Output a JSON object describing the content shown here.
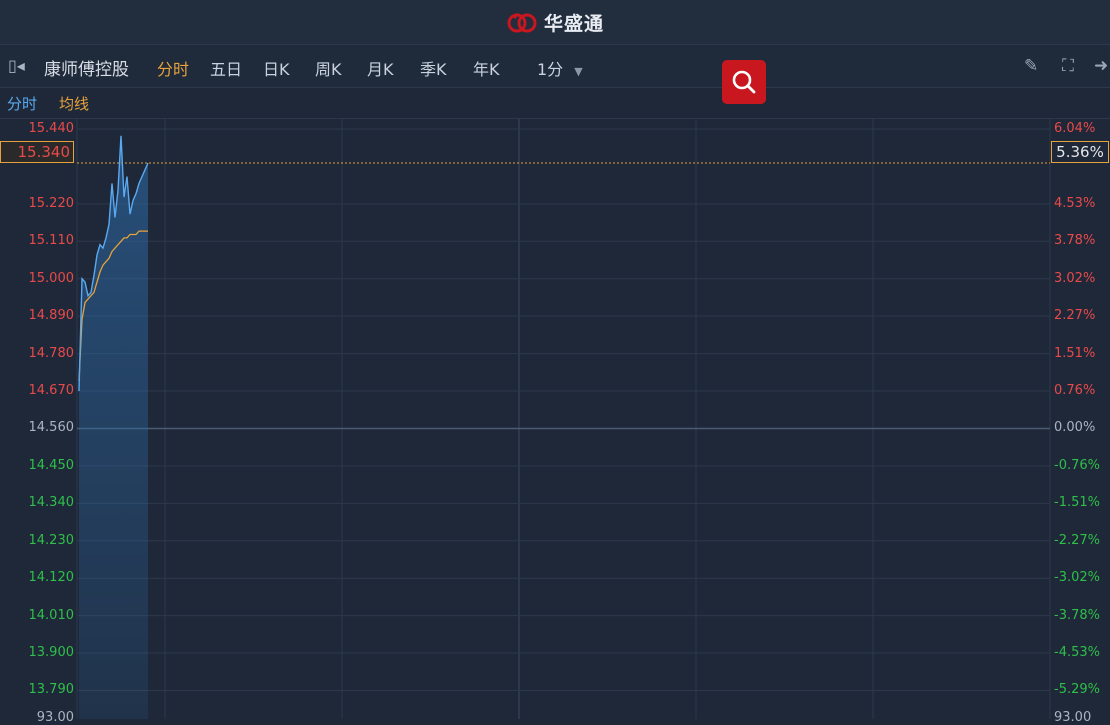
{
  "app": {
    "brand": "华盛通"
  },
  "toolbar": {
    "stock_name": "康师傅控股",
    "periods": [
      {
        "label": "分时",
        "active": true
      },
      {
        "label": "五日",
        "active": false
      },
      {
        "label": "日K",
        "active": false
      },
      {
        "label": "周K",
        "active": false
      },
      {
        "label": "月K",
        "active": false
      },
      {
        "label": "季K",
        "active": false
      },
      {
        "label": "年K",
        "active": false
      }
    ],
    "interval": "1分"
  },
  "legend": {
    "price": "分时",
    "avg": "均线"
  },
  "colors": {
    "price_line": "#5aa9f0",
    "avg_line": "#e6a23c",
    "up": "#e84a4a",
    "down": "#2fbf4a",
    "flat": "#aab4c2",
    "brand_red": "#c8171e"
  },
  "current": {
    "price": "15.340",
    "pct": "5.36%"
  },
  "bottom_label": "93.00",
  "chart_data": {
    "type": "line",
    "prev_close": 14.56,
    "ylim": [
      13.735,
      15.44
    ],
    "y_ticks": [
      {
        "price": "15.440",
        "pct": "6.04%"
      },
      {
        "price": "15.220",
        "pct": "4.53%"
      },
      {
        "price": "15.110",
        "pct": "3.78%"
      },
      {
        "price": "15.000",
        "pct": "3.02%"
      },
      {
        "price": "14.890",
        "pct": "2.27%"
      },
      {
        "price": "14.780",
        "pct": "1.51%"
      },
      {
        "price": "14.670",
        "pct": "0.76%"
      },
      {
        "price": "14.560",
        "pct": "0.00%"
      },
      {
        "price": "14.450",
        "pct": "-0.76%"
      },
      {
        "price": "14.340",
        "pct": "-1.51%"
      },
      {
        "price": "14.230",
        "pct": "-2.27%"
      },
      {
        "price": "14.120",
        "pct": "-3.02%"
      },
      {
        "price": "14.010",
        "pct": "-3.78%"
      },
      {
        "price": "13.900",
        "pct": "-4.53%"
      },
      {
        "price": "13.790",
        "pct": "-5.29%"
      }
    ],
    "session_minutes": 330,
    "series": [
      {
        "name": "分时",
        "x": [
          0,
          1,
          2,
          3,
          4,
          5,
          6,
          7,
          8,
          9,
          10,
          11,
          12,
          13,
          14,
          15,
          16,
          17,
          18,
          19,
          20,
          21,
          22,
          23
        ],
        "values": [
          14.67,
          15.0,
          14.99,
          14.95,
          14.96,
          15.01,
          15.07,
          15.1,
          15.09,
          15.12,
          15.16,
          15.28,
          15.18,
          15.26,
          15.42,
          15.24,
          15.3,
          15.19,
          15.23,
          15.25,
          15.28,
          15.3,
          15.32,
          15.34
        ]
      },
      {
        "name": "均线",
        "x": [
          0,
          1,
          2,
          3,
          4,
          5,
          6,
          7,
          8,
          9,
          10,
          11,
          12,
          13,
          14,
          15,
          16,
          17,
          18,
          19,
          20,
          21,
          22,
          23
        ],
        "values": [
          14.7,
          14.88,
          14.93,
          14.94,
          14.95,
          14.96,
          14.99,
          15.02,
          15.04,
          15.05,
          15.06,
          15.08,
          15.09,
          15.1,
          15.11,
          15.12,
          15.12,
          15.13,
          15.13,
          15.13,
          15.14,
          15.14,
          15.14,
          15.14
        ]
      }
    ]
  }
}
